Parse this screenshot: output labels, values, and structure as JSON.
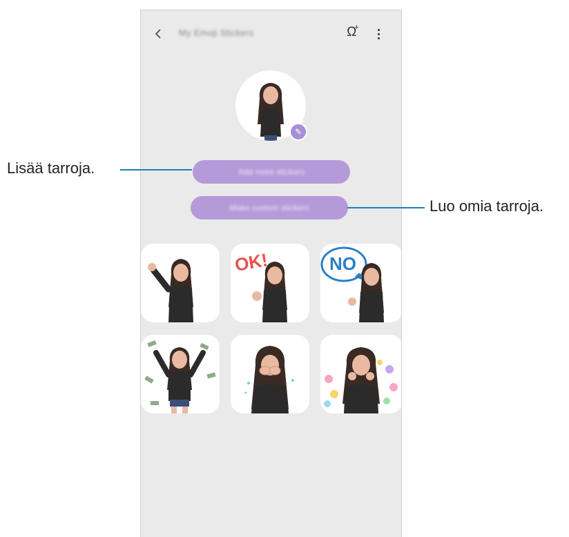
{
  "appbar": {
    "title": "My Emoji Stickers",
    "back_icon": "chevron-left-icon",
    "add_person_icon": "add-person-icon",
    "more_icon": "more-vertical-icon"
  },
  "buttons": {
    "add_more": "Add more stickers",
    "make_custom": "Make custom stickers"
  },
  "callouts": {
    "left": "Lisää tarroja.",
    "right": "Luo omia tarroja."
  },
  "stickers": [
    {
      "name": "wave",
      "text": ""
    },
    {
      "name": "ok",
      "text": "OK!"
    },
    {
      "name": "no",
      "text": "NO"
    },
    {
      "name": "money-rain",
      "text": ""
    },
    {
      "name": "cover-face",
      "text": ""
    },
    {
      "name": "hearts",
      "text": ""
    }
  ],
  "colors": {
    "accent": "#b59ad9",
    "callout_line": "#1a7fb8",
    "background": "#eaeaea"
  }
}
